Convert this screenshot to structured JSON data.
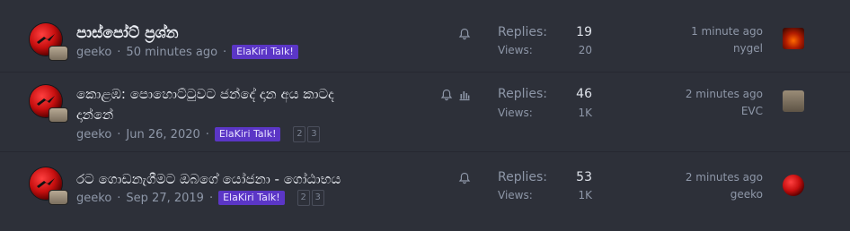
{
  "threads": [
    {
      "title": "පාස්පෝට් ප්‍රශ්න",
      "author": "geeko",
      "date": "50 minutes ago",
      "prefix": "ElaKiri Talk!",
      "pages": [],
      "icons": [
        "bell-icon"
      ],
      "replies_label": "Replies:",
      "replies": "19",
      "views_label": "Views:",
      "views": "20",
      "last_time": "1 minute ago",
      "last_user": "nygel"
    },
    {
      "title_line1": "කොළඹ: පොහොට්ටුවට ජන්දේ දාන අය කාටද",
      "title_line2": "දාන්නේ",
      "author": "geeko",
      "date": "Jun 26, 2020",
      "prefix": "ElaKiri Talk!",
      "pages": [
        "2",
        "3"
      ],
      "icons": [
        "bell-icon",
        "poll-icon"
      ],
      "replies_label": "Replies:",
      "replies": "46",
      "views_label": "Views:",
      "views": "1K",
      "last_time": "2 minutes ago",
      "last_user": "EVC"
    },
    {
      "title": "රට ගොඩනැගීමට ඔබගේ යෝජනා - ගෝඨාභය",
      "author": "geeko",
      "date": "Sep 27, 2019",
      "prefix": "ElaKiri Talk!",
      "pages": [
        "2",
        "3"
      ],
      "icons": [
        "bell-icon"
      ],
      "replies_label": "Replies:",
      "replies": "53",
      "views_label": "Views:",
      "views": "1K",
      "last_time": "2 minutes ago",
      "last_user": "geeko"
    }
  ],
  "separator": "·",
  "colors": {
    "background": "#2d3039",
    "prefix_badge": "#5b36c6",
    "title": "#e9ecf2",
    "muted": "#8e97a8"
  }
}
